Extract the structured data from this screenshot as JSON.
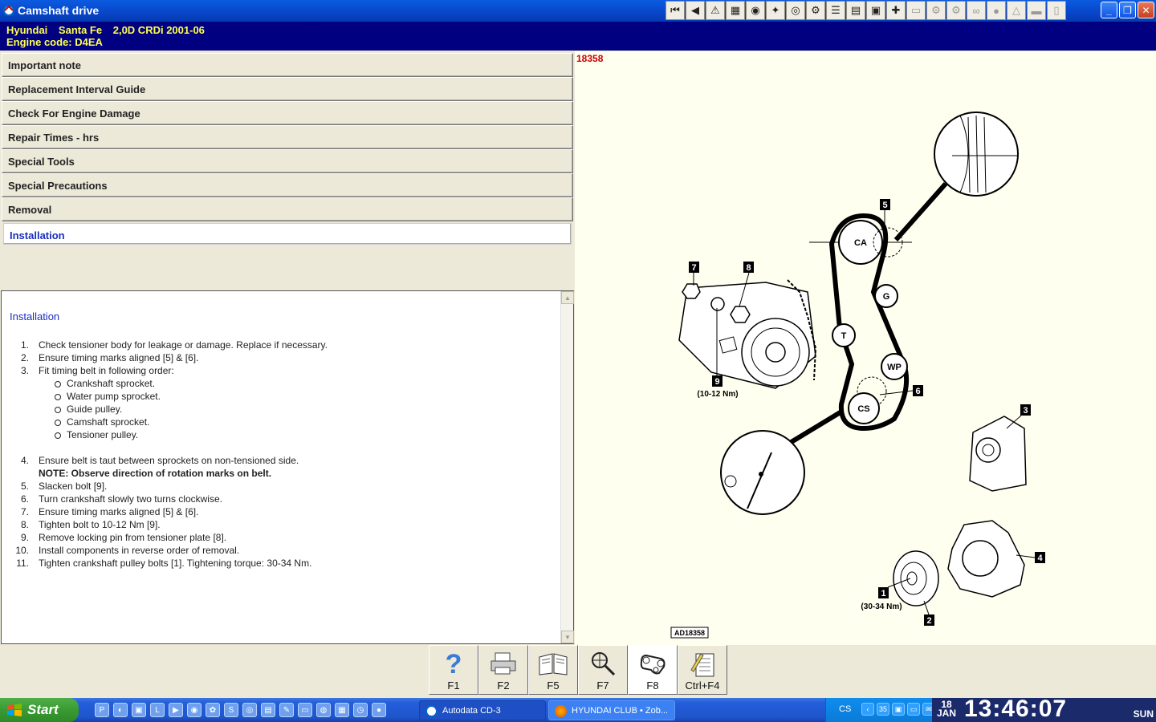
{
  "window": {
    "title": "Camshaft drive",
    "toolbar_icons": [
      "first-icon",
      "back-icon",
      "warning-icon",
      "map-icon",
      "globe-icon",
      "wrench-icon",
      "gauge-icon",
      "timing-icon",
      "list-icon",
      "printer-doc-icon",
      "calc-icon",
      "help-icon",
      "doc-icon",
      "engine-icon",
      "gear-icon",
      "belt-icon",
      "bulb-icon",
      "warning-triangle-icon",
      "car-icon",
      "battery-icon"
    ]
  },
  "vehicle": {
    "make": "Hyundai",
    "model": "Santa Fe",
    "variant": "2,0D CRDi 2001-06",
    "engine_line": "Engine code: D4EA"
  },
  "nav": {
    "items": [
      "Important note",
      "Replacement Interval Guide",
      "Check For Engine Damage",
      "Repair Times - hrs",
      "Special Tools",
      "Special Precautions",
      "Removal"
    ],
    "active": "Installation"
  },
  "content": {
    "heading": "Installation",
    "steps": [
      {
        "n": "1.",
        "text": "Check tensioner body for leakage or damage. Replace if necessary."
      },
      {
        "n": "2.",
        "text": "Ensure timing marks aligned [5] & [6]."
      },
      {
        "n": "3.",
        "text": "Fit timing belt in following order:"
      },
      {
        "n": "4.",
        "text": "Ensure belt is taut between sprockets on non-tensioned side."
      },
      {
        "n": "5.",
        "text": "Slacken bolt [9]."
      },
      {
        "n": "6.",
        "text": "Turn crankshaft slowly two turns clockwise."
      },
      {
        "n": "7.",
        "text": "Ensure timing marks aligned [5] & [6]."
      },
      {
        "n": "8.",
        "text": "Tighten bolt to 10-12 Nm [9]."
      },
      {
        "n": "9.",
        "text": "Remove locking pin from tensioner plate [8]."
      },
      {
        "n": "10.",
        "text": "Install components in reverse order of removal."
      },
      {
        "n": "11.",
        "text": "Tighten crankshaft pulley bolts [1]. Tightening torque: 30-34 Nm."
      }
    ],
    "belt_order": [
      "Crankshaft sprocket.",
      "Water pump sprocket.",
      "Guide pulley.",
      "Camshaft sprocket.",
      "Tensioner pulley."
    ],
    "note": "NOTE: Observe direction of rotation marks on belt."
  },
  "diagram": {
    "ref_number": "18358",
    "figure_code": "AD18358",
    "pulleys": {
      "ca": "CA",
      "g": "G",
      "t": "T",
      "wp": "WP",
      "cs": "CS"
    },
    "callouts": {
      "c1": "1",
      "c2": "2",
      "c3": "3",
      "c4": "4",
      "c5": "5",
      "c6": "6",
      "c7": "7",
      "c8": "8",
      "c9": "9"
    },
    "torque_9": "(10-12 Nm)",
    "torque_1": "(30-34 Nm)"
  },
  "fkeys": [
    {
      "key": "F1",
      "icon": "help-icon"
    },
    {
      "key": "F2",
      "icon": "printer-icon"
    },
    {
      "key": "F5",
      "icon": "book-icon"
    },
    {
      "key": "F7",
      "icon": "magnifier-icon"
    },
    {
      "key": "F8",
      "icon": "belt-icon"
    },
    {
      "key": "Ctrl+F4",
      "icon": "notepad-icon"
    }
  ],
  "taskbar": {
    "start_label": "Start",
    "tasks": [
      "Autodata CD-3",
      "HYUNDAI CLUB • Zob..."
    ],
    "lang": "CS",
    "tray_num": "35",
    "clock": {
      "day": "18",
      "month": "JAN",
      "time": "13:46:07",
      "weekday": "SUN"
    }
  }
}
